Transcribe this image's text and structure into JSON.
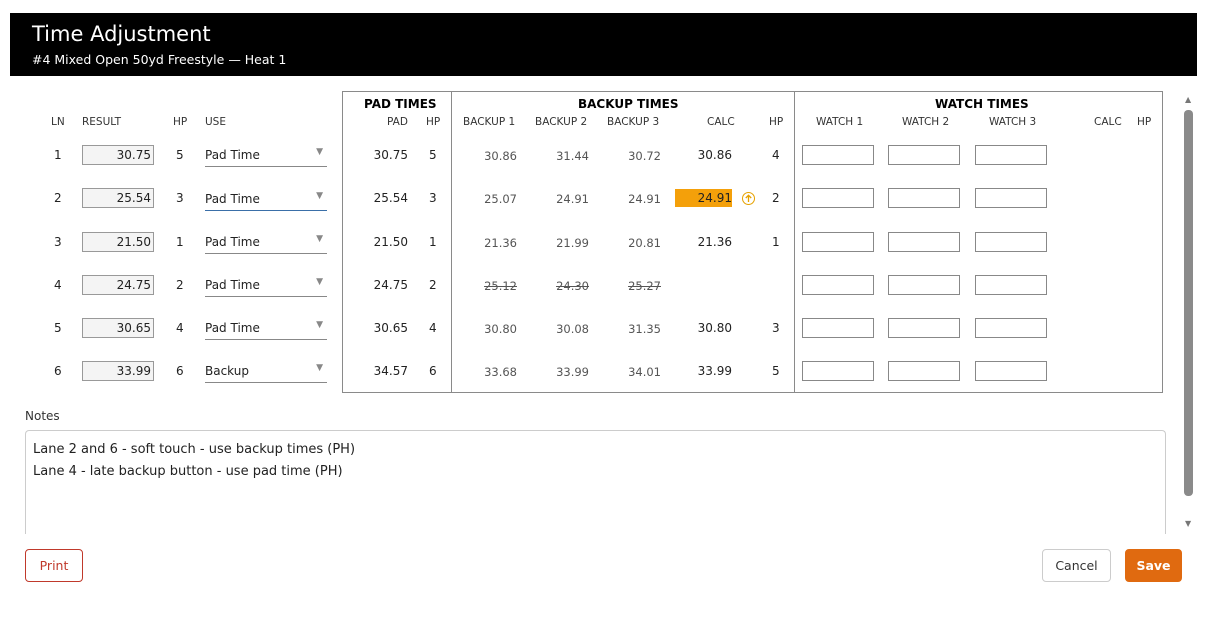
{
  "title": "Time Adjustment",
  "subtitle": "#4 Mixed Open 50yd Freestyle — Heat 1",
  "headers": {
    "ln": "LN",
    "result": "RESULT",
    "hp": "HP",
    "use": "USE",
    "pad_group": "PAD TIMES",
    "pad": "PAD",
    "pad_hp": "HP",
    "backup_group": "BACKUP TIMES",
    "backup1": "BACKUP 1",
    "backup2": "BACKUP 2",
    "backup3": "BACKUP 3",
    "calc": "CALC",
    "backup_hp": "HP",
    "watch_group": "WATCH TIMES",
    "watch1": "WATCH 1",
    "watch2": "WATCH 2",
    "watch3": "WATCH 3",
    "watch_calc": "CALC",
    "watch_hp": "HP"
  },
  "rows": [
    {
      "ln": "1",
      "result": "30.75",
      "hp": "5",
      "use": "Pad Time",
      "pad": "30.75",
      "pad_hp": "5",
      "b1": "30.86",
      "b2": "31.44",
      "b3": "30.72",
      "calc": "30.86",
      "bhp": "4"
    },
    {
      "ln": "2",
      "result": "25.54",
      "hp": "3",
      "use": "Pad Time",
      "pad": "25.54",
      "pad_hp": "3",
      "b1": "25.07",
      "b2": "24.91",
      "b3": "24.91",
      "calc": "24.91",
      "bhp": "2"
    },
    {
      "ln": "3",
      "result": "21.50",
      "hp": "1",
      "use": "Pad Time",
      "pad": "21.50",
      "pad_hp": "1",
      "b1": "21.36",
      "b2": "21.99",
      "b3": "20.81",
      "calc": "21.36",
      "bhp": "1"
    },
    {
      "ln": "4",
      "result": "24.75",
      "hp": "2",
      "use": "Pad Time",
      "pad": "24.75",
      "pad_hp": "2",
      "b1": "25.12",
      "b2": "24.30",
      "b3": "25.27",
      "calc": "",
      "bhp": ""
    },
    {
      "ln": "5",
      "result": "30.65",
      "hp": "4",
      "use": "Pad Time",
      "pad": "30.65",
      "pad_hp": "4",
      "b1": "30.80",
      "b2": "30.08",
      "b3": "31.35",
      "calc": "30.80",
      "bhp": "3"
    },
    {
      "ln": "6",
      "result": "33.99",
      "hp": "6",
      "use": "Backup",
      "pad": "34.57",
      "pad_hp": "6",
      "b1": "33.68",
      "b2": "33.99",
      "b3": "34.01",
      "calc": "33.99",
      "bhp": "5"
    }
  ],
  "highlight_color": "#f4a00a",
  "notes_label": "Notes",
  "notes": [
    "Lane 2 and 6 - soft touch - use backup times (PH)",
    "Lane 4 - late backup button - use pad time (PH)"
  ],
  "buttons": {
    "print": "Print",
    "cancel": "Cancel",
    "save": "Save"
  },
  "accent_color": "#e06a10"
}
